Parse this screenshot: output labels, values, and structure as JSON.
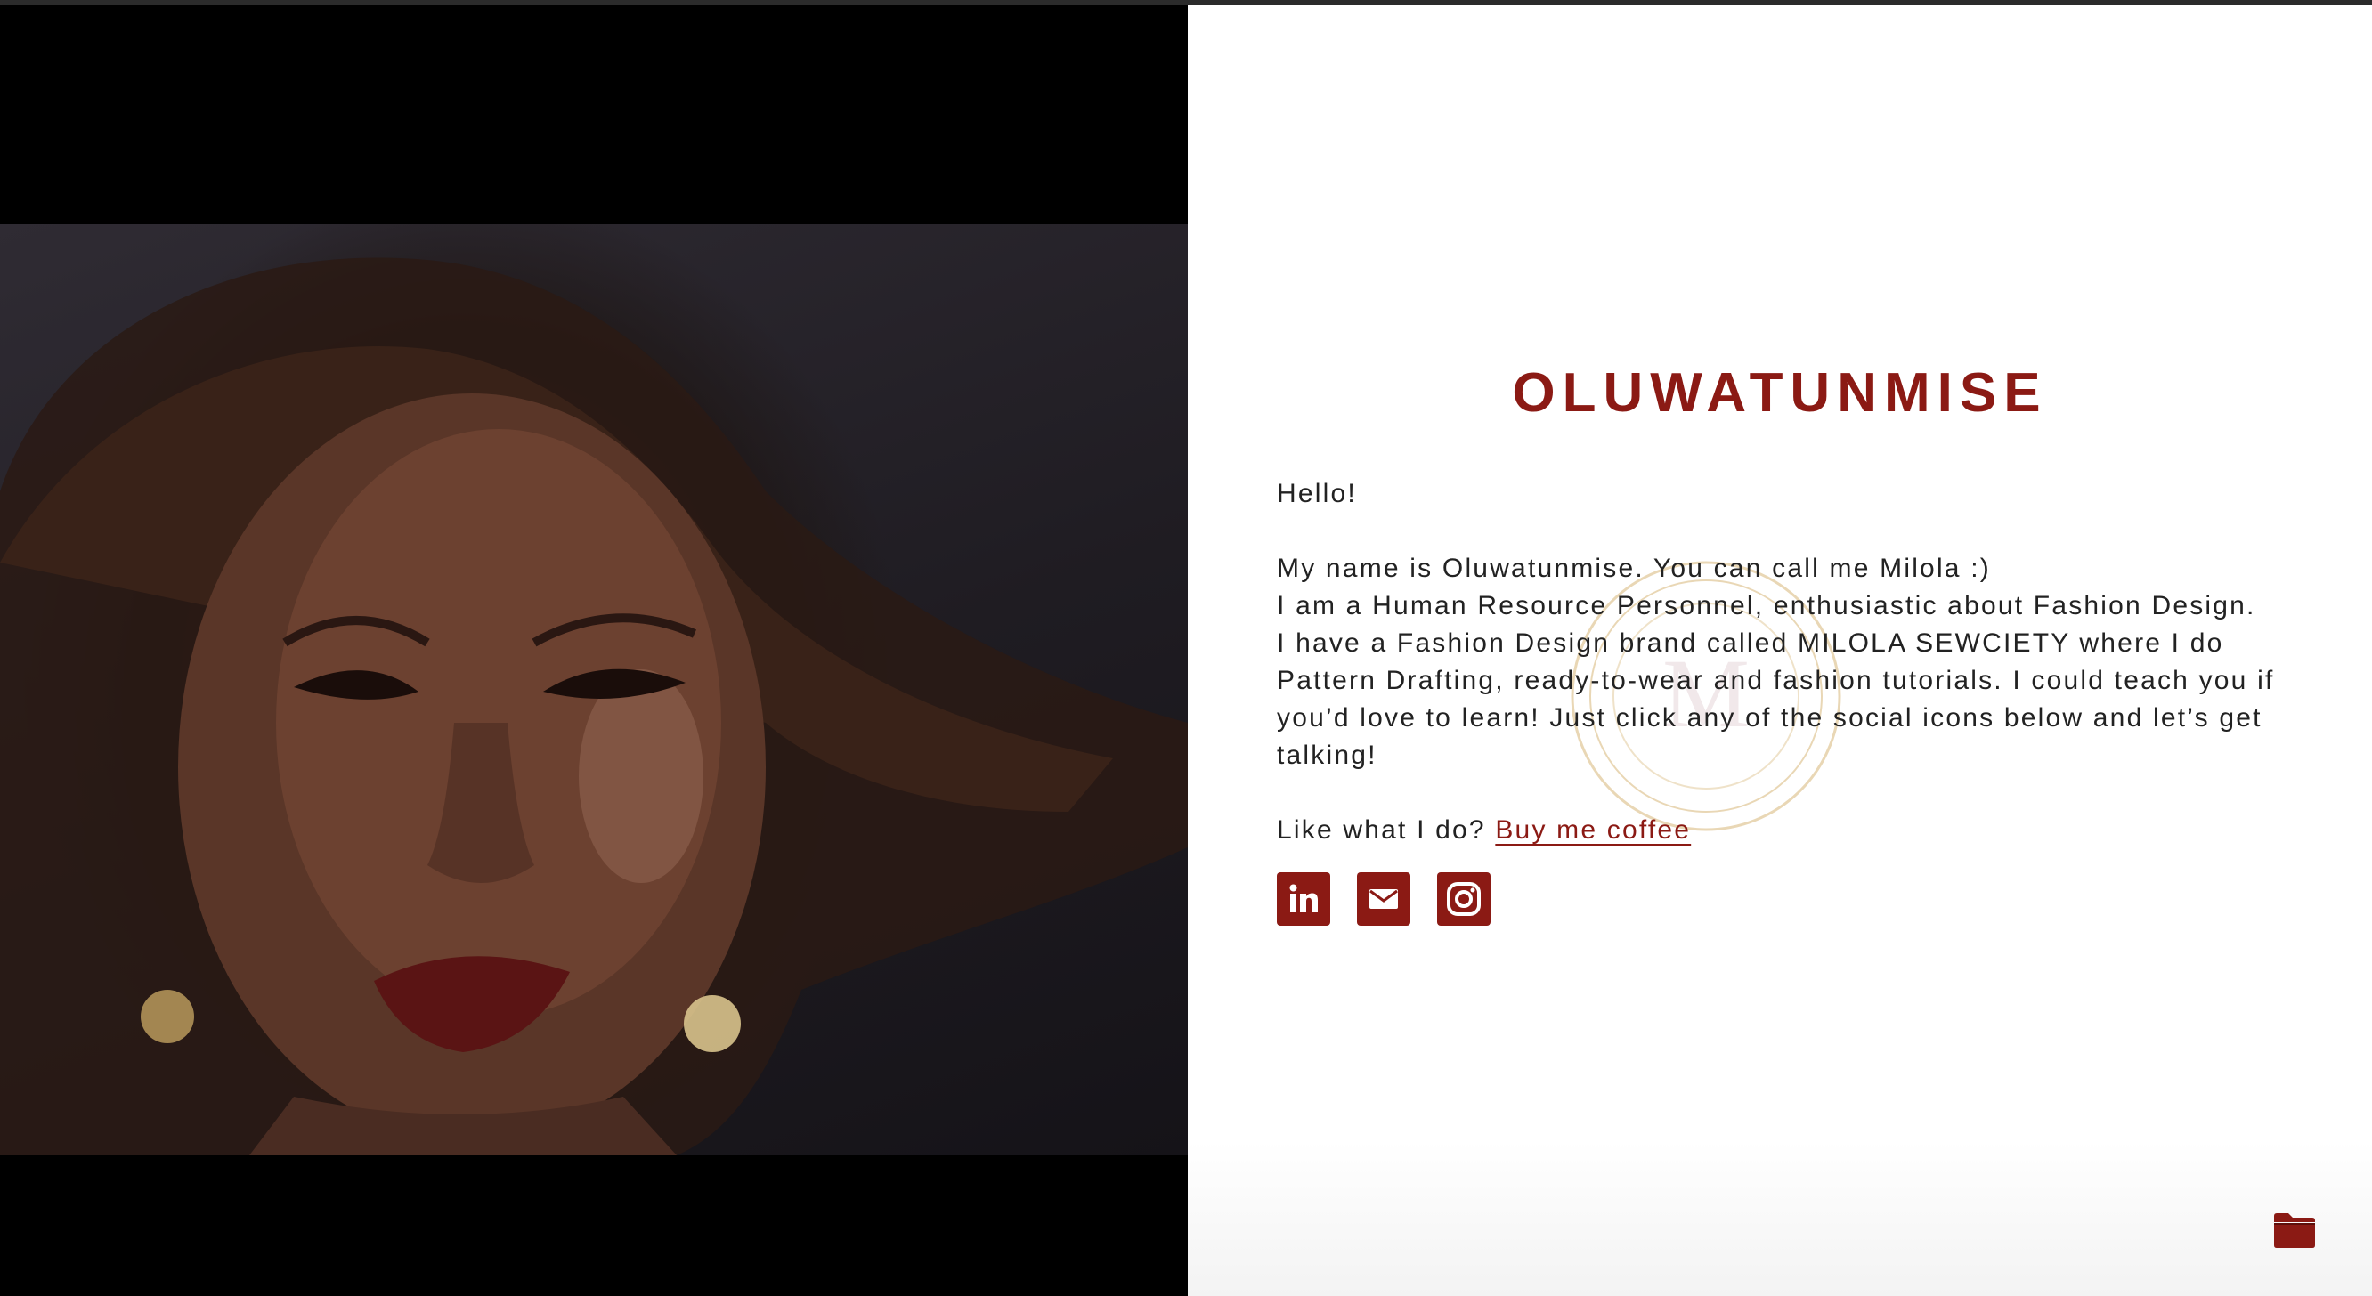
{
  "profile": {
    "name": "OLUWATUNMISE",
    "greeting": "Hello!",
    "intro_line1": "My name is Oluwatunmise. You can call me Milola :)",
    "intro_line2": "I am a Human Resource Personnel, enthusiastic about Fashion Design.",
    "intro_line3": "I have a Fashion Design brand called MILOLA SEWCIETY where I do Pattern Drafting, ready-to-wear and fashion tutorials. I could teach you if you’d love to learn! Just click any of the social icons below and let’s get talking!",
    "support_prefix": "Like what I do?",
    "support_link": "Buy me coffee"
  },
  "socials": [
    {
      "icon": "linkedin-icon"
    },
    {
      "icon": "email-icon"
    },
    {
      "icon": "instagram-icon"
    }
  ],
  "colors": {
    "accent": "#8b1a14",
    "text": "#222222",
    "photo_bg": "#000000"
  }
}
